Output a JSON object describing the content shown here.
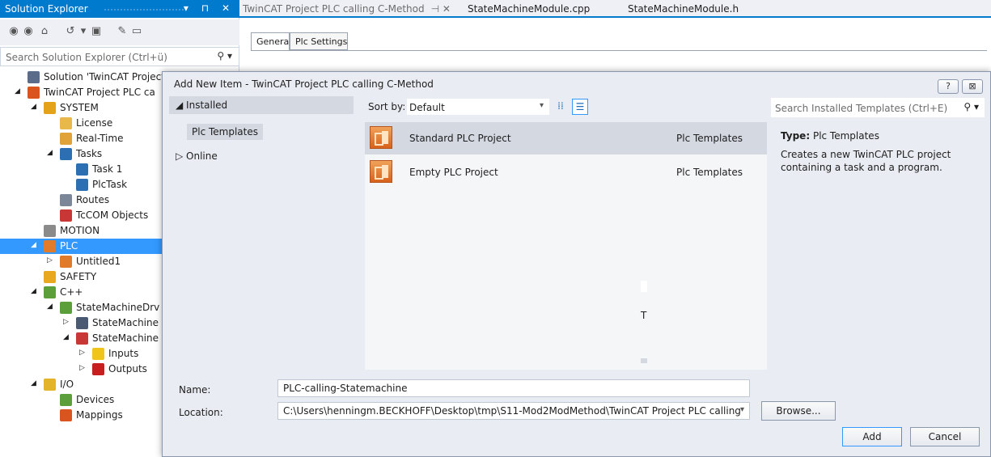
{
  "solution_explorer": {
    "title": "Solution Explorer",
    "title_buttons": "▾ ⊓ ✕",
    "search_placeholder": "Search Solution Explorer (Ctrl+ü)",
    "tree": [
      {
        "label": "Solution 'TwinCAT Project P",
        "depth": 0,
        "expander": "",
        "icon_color": "#5a6c8a",
        "selected": false
      },
      {
        "label": "TwinCAT Project PLC ca",
        "depth": 0,
        "expander": "◢",
        "icon_color": "#d9541e",
        "selected": false
      },
      {
        "label": "SYSTEM",
        "depth": 1,
        "expander": "◢",
        "icon_color": "#e3a21a",
        "selected": false
      },
      {
        "label": "License",
        "depth": 2,
        "expander": "",
        "icon_color": "#e8b84a",
        "selected": false
      },
      {
        "label": "Real-Time",
        "depth": 2,
        "expander": "",
        "icon_color": "#e2a23a",
        "selected": false
      },
      {
        "label": "Tasks",
        "depth": 2,
        "expander": "◢",
        "icon_color": "#2d6fb3",
        "selected": false
      },
      {
        "label": "Task 1",
        "depth": 3,
        "expander": "",
        "icon_color": "#2d6fb3",
        "selected": false
      },
      {
        "label": "PlcTask",
        "depth": 3,
        "expander": "",
        "icon_color": "#2d6fb3",
        "selected": false
      },
      {
        "label": "Routes",
        "depth": 2,
        "expander": "",
        "icon_color": "#7b8799",
        "selected": false
      },
      {
        "label": "TcCOM Objects",
        "depth": 2,
        "expander": "",
        "icon_color": "#c93636",
        "selected": false
      },
      {
        "label": "MOTION",
        "depth": 1,
        "expander": "",
        "icon_color": "#8a8a8a",
        "selected": false
      },
      {
        "label": "PLC",
        "depth": 1,
        "expander": "◢",
        "icon_color": "#e07b2c",
        "selected": true
      },
      {
        "label": "Untitled1",
        "depth": 2,
        "expander": "▷",
        "icon_color": "#e07b2c",
        "selected": false
      },
      {
        "label": "SAFETY",
        "depth": 1,
        "expander": "",
        "icon_color": "#e8a81f",
        "selected": false
      },
      {
        "label": "C++",
        "depth": 1,
        "expander": "◢",
        "icon_color": "#5c9e3a",
        "selected": false
      },
      {
        "label": "StateMachineDrv",
        "depth": 2,
        "expander": "◢",
        "icon_color": "#5c9e3a",
        "selected": false
      },
      {
        "label": "StateMachine",
        "depth": 3,
        "expander": "▷",
        "icon_color": "#4a5a73",
        "selected": false
      },
      {
        "label": "StateMachine",
        "depth": 3,
        "expander": "◢",
        "icon_color": "#c93636",
        "selected": false
      },
      {
        "label": "Inputs",
        "depth": 4,
        "expander": "▷",
        "icon_color": "#f0c419",
        "selected": false
      },
      {
        "label": "Outputs",
        "depth": 4,
        "expander": "▷",
        "icon_color": "#c81e1e",
        "selected": false
      },
      {
        "label": "I/O",
        "depth": 1,
        "expander": "◢",
        "icon_color": "#e3b32a",
        "selected": false
      },
      {
        "label": "Devices",
        "depth": 2,
        "expander": "",
        "icon_color": "#5c9e3a",
        "selected": false
      },
      {
        "label": "Mappings",
        "depth": 2,
        "expander": "",
        "icon_color": "#d9541e",
        "selected": false
      }
    ]
  },
  "editor_tabs": [
    {
      "label": "TwinCAT Project PLC calling C-Method",
      "active": true,
      "pin": "⊣ ✕"
    },
    {
      "label": "StateMachineModule.cpp",
      "active": false
    },
    {
      "label": "StateMachineModule.h",
      "active": false
    }
  ],
  "inner_tabs": [
    "General",
    "Plc Settings"
  ],
  "dialog": {
    "title": "Add New Item - TwinCAT Project PLC calling C-Method",
    "help_btn": "?",
    "close_btn": "⊠",
    "left": {
      "installed": "◢ Installed",
      "plc_templates": "Plc Templates",
      "online": "▷ Online"
    },
    "sort_label": "Sort by:",
    "sort_value": "Default",
    "search_placeholder": "Search Installed Templates (Ctrl+E)",
    "templates": [
      {
        "name": "Standard PLC Project",
        "category": "Plc Templates",
        "selected": true
      },
      {
        "name": "Empty PLC Project",
        "category": "Plc Templates",
        "selected": false
      }
    ],
    "info": {
      "type_label": "Type:",
      "type_value": "Plc Templates",
      "description": "Creates a new TwinCAT PLC project containing a task and a program."
    },
    "name_label": "Name:",
    "name_value": "PLC-calling-Statemachine",
    "location_label": "Location:",
    "location_value": "C:\\Users\\henningm.BECKHOFF\\Desktop\\tmp\\S11-Mod2ModMethod\\TwinCAT Project PLC calling",
    "browse": "Browse...",
    "add": "Add",
    "cancel": "Cancel",
    "artifact_text": "T"
  }
}
